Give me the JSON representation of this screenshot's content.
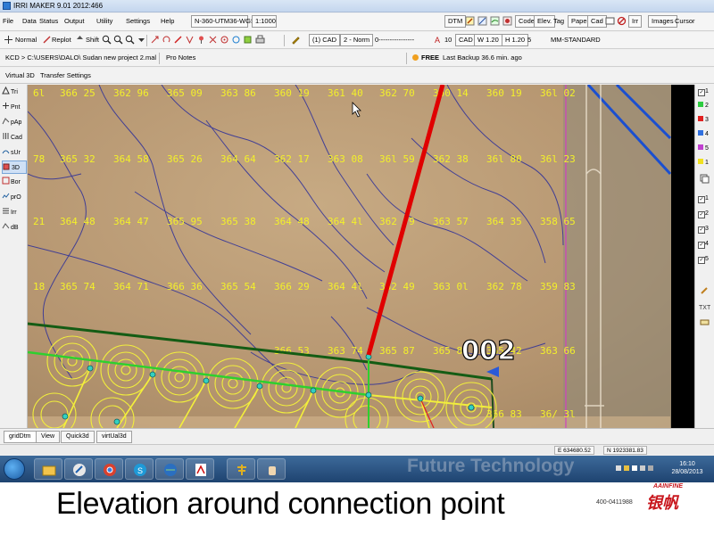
{
  "window": {
    "title": "IRRI MAKER  9.01   2012:466"
  },
  "menu": {
    "items": [
      "File",
      "Data",
      "Status",
      "Output",
      "Utility",
      "Settings",
      "Help"
    ],
    "projection": "N-360-UTM36-WGS",
    "scale": "1:1000",
    "right_buttons": [
      "DTM",
      "Code",
      "Elev.",
      "Tag",
      "Paper",
      "Cad",
      "Irr",
      "Images",
      "Cursor"
    ]
  },
  "toolbar": {
    "modes": [
      "Normal",
      "Replot",
      "Shift"
    ],
    "layer_select": "(1) CAD",
    "line_mode": "2 - Norm",
    "line_style": "0----------------",
    "text_size": "10",
    "text_layer": "CAD",
    "width": "W 1.20",
    "height": "H 1.20",
    "count": "5",
    "style": "MM-STANDARD"
  },
  "pathbar": {
    "path": "KCD > C:\\USERS\\DALO\\ Sudan new project 2.mal",
    "notes": "Pro Notes",
    "free": "FREE",
    "backup": "Last Backup 36.6 min. ago"
  },
  "tabs": [
    "Virtual 3D",
    "Transfer Settings"
  ],
  "left_tools": [
    "Tri",
    "Pnt",
    "pAp",
    "Cad",
    "sUr",
    "3D",
    "Bor",
    "prO",
    "Irr",
    "dB"
  ],
  "map": {
    "label": "002",
    "grid_rows": [
      [
        "6l",
        "366 25",
        "362 96",
        "365 09",
        "363 86",
        "360 19",
        "361 40",
        "362 70",
        "360 14",
        "360 19",
        "36l 02"
      ],
      [
        "78",
        "365 32",
        "364 58",
        "365 26",
        "364 64",
        "362 17",
        "363 08",
        "36l 59",
        "362 38",
        "36l 80",
        "36l 23"
      ],
      [
        "21",
        "364 48",
        "364 47",
        "365 95",
        "365 38",
        "364 48",
        "364 4l",
        "362 79",
        "363 57",
        "364 35",
        "358 65"
      ],
      [
        "18",
        "365 74",
        "364 71",
        "366 36",
        "365 54",
        "366 29",
        "364 4l",
        "362 49",
        "363 0l",
        "362 78",
        "359 83"
      ],
      [
        "",
        "",
        "",
        "",
        "",
        "366 53",
        "363 74",
        "365 87",
        "365 85",
        "365 42",
        "363 66"
      ],
      [
        "",
        "",
        "",
        "",
        "",
        "",
        "",
        "",
        "",
        "366 83",
        "36/ 3l"
      ]
    ]
  },
  "layers": {
    "top": [
      "1",
      "2",
      "3",
      "4",
      "5",
      "1"
    ],
    "bottom": [
      "1",
      "2",
      "3",
      "4",
      "5"
    ],
    "top_colors": [
      "#ffffff",
      "#2ecc40",
      "#e02020",
      "#3070e0",
      "#c040d0",
      "#f0e020"
    ]
  },
  "bottom_tabs": [
    "gridDtm",
    "View",
    "Quick3d",
    "virtUal3d"
  ],
  "status": {
    "easting": "E 634680.52",
    "northing": "N 1923381.83"
  },
  "taskbar": {
    "watermark": "Future Technology",
    "time": "16:10",
    "date": "28/08/2013"
  },
  "slide": {
    "caption": "Elevation around connection point",
    "logo_en": "AAINFINE",
    "logo_cn": "银帆",
    "phone": "400-0411988"
  }
}
